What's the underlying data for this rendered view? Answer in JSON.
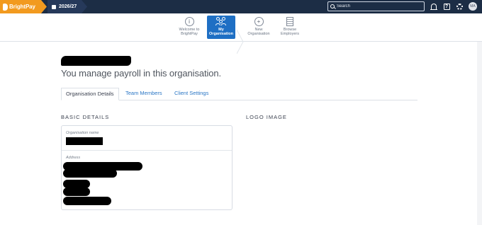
{
  "app": {
    "brand": "BrightPay",
    "tax_year": "2026/27"
  },
  "search": {
    "placeholder": "Search"
  },
  "user": {
    "initials": "MA"
  },
  "nav": {
    "items": [
      {
        "label": "Welcome to\nBrightPay",
        "icon": "info-icon",
        "active": false
      },
      {
        "label": "My\nOrganisation",
        "icon": "people-icon",
        "active": true
      },
      {
        "label": "New\nOrganisation",
        "icon": "plus-icon",
        "active": false
      },
      {
        "label": "Browse\nEmployers",
        "icon": "building-icon",
        "active": false
      }
    ]
  },
  "page": {
    "subtitle": "You manage payroll in this organisation."
  },
  "tabs": [
    "Organisation Details",
    "Team Members",
    "Client Settings"
  ],
  "sections": {
    "basic": "BASIC DETAILS",
    "logo": "LOGO IMAGE"
  },
  "fields": {
    "org_name_label": "Organisation name",
    "address_label": "Address"
  },
  "colors": {
    "topbar": "#1c2d45",
    "brand": "#f29a1f",
    "accent": "#1e6fc4",
    "link": "#2a76c5"
  }
}
